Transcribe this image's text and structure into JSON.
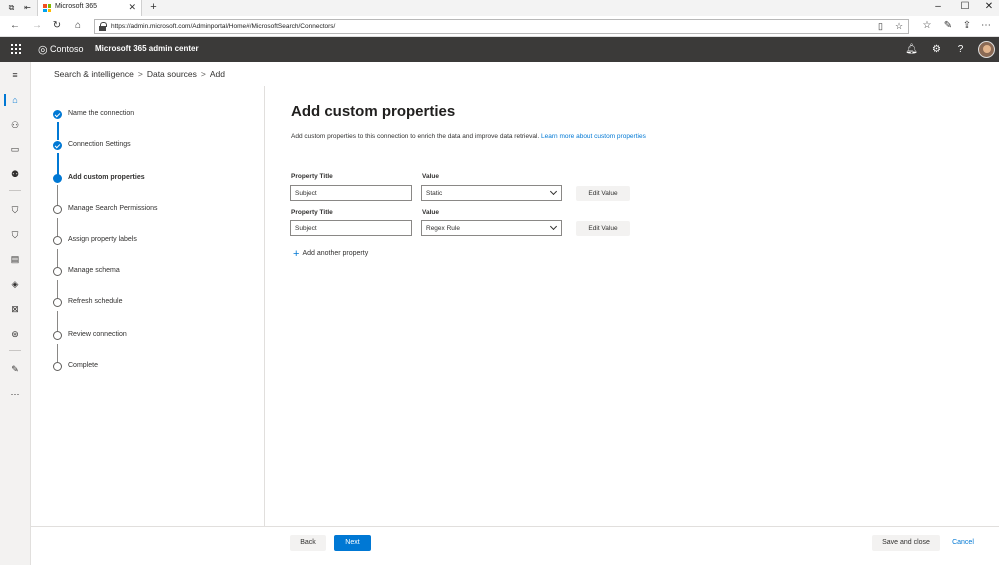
{
  "browser": {
    "tab_title": "Microsoft 365",
    "url": "https://admin.microsoft.com/Adminportal/Home#/MicrosoftSearch/Connectors/"
  },
  "suite_header": {
    "org_name": "Contoso",
    "app_name": "Microsoft 365 admin center"
  },
  "breadcrumb": {
    "items": [
      "Search & intelligence",
      "Data sources",
      "Add"
    ],
    "separator": ">"
  },
  "wizard": {
    "steps": [
      {
        "label": "Name the connection",
        "state": "done"
      },
      {
        "label": "Connection Settings",
        "state": "done"
      },
      {
        "label": "Add custom properties",
        "state": "current"
      },
      {
        "label": "Manage Search Permissions",
        "state": "pending"
      },
      {
        "label": "Assign property labels",
        "state": "pending"
      },
      {
        "label": "Manage schema",
        "state": "pending"
      },
      {
        "label": "Refresh schedule",
        "state": "pending"
      },
      {
        "label": "Review connection",
        "state": "pending"
      },
      {
        "label": "Complete",
        "state": "pending"
      }
    ]
  },
  "main": {
    "title": "Add custom properties",
    "description": "Add custom properties to this connection to enrich the data and improve data retrieval.",
    "learn_more_link": "Learn more about custom properties",
    "properties": [
      {
        "title_label": "Property Title",
        "title_value": "Subject",
        "value_label": "Value",
        "value_selected": "Static",
        "edit_label": "Edit Value"
      },
      {
        "title_label": "Property Title",
        "title_value": "Subject",
        "value_label": "Value",
        "value_selected": "Regex Rule",
        "edit_label": "Edit Value"
      }
    ],
    "add_another_label": "Add another property"
  },
  "footer": {
    "back_label": "Back",
    "next_label": "Next",
    "save_close_label": "Save and close",
    "cancel_label": "Cancel"
  },
  "colors": {
    "accent": "#0078d4",
    "suite_bar": "#3b3a39"
  },
  "icons": {
    "rail": [
      "hamburger-icon",
      "home-icon",
      "users-icon",
      "devices-icon",
      "groups-icon",
      "security-icon",
      "compliance-icon",
      "billing-icon",
      "endpoint-icon",
      "exchange-icon",
      "sharepoint-icon",
      "customize-icon",
      "more-icon"
    ],
    "header": [
      "notification-bell-icon",
      "settings-gear-icon",
      "help-icon"
    ]
  }
}
